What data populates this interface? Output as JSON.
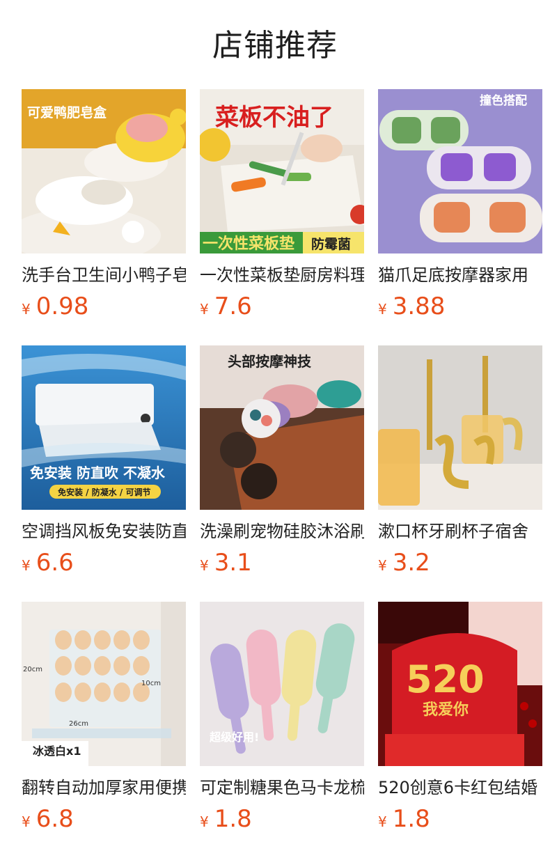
{
  "header": {
    "title": "店铺推荐"
  },
  "products": [
    {
      "name": "洗手台卫生间小鸭子皂盒",
      "currency": "¥",
      "price": "0.98",
      "image_text": "可爱鸭肥皂盒",
      "image_icon": "duck-soap-dish-icon"
    },
    {
      "name": "一次性菜板垫厨房料理",
      "currency": "¥",
      "price": "7.6",
      "image_text": "菜板不油了",
      "image_text2": "一次性菜板垫",
      "image_text3": "防霉菌",
      "image_icon": "cutting-board-mat-icon"
    },
    {
      "name": "猫爪足底按摩器家用",
      "currency": "¥",
      "price": "3.88",
      "image_text": "撞色搭配",
      "image_icon": "foot-massager-icon"
    },
    {
      "name": "空调挡风板免安装防直吹",
      "currency": "¥",
      "price": "6.6",
      "image_text": "免安装 防直吹 不凝水",
      "image_text2": "免安装 / 防凝水 / 可调节",
      "image_icon": "ac-deflector-icon"
    },
    {
      "name": "洗澡刷宠物硅胶沐浴刷",
      "currency": "¥",
      "price": "3.1",
      "image_text": "头部按摩神技",
      "image_icon": "bath-brush-icon"
    },
    {
      "name": "漱口杯牙刷杯子宿舍",
      "currency": "¥",
      "price": "3.2",
      "image_icon": "toothbrush-cup-icon"
    },
    {
      "name": "翻转自动加厚家用便携",
      "currency": "¥",
      "price": "6.8",
      "image_text": "冰透白x1",
      "image_text2": "20cm",
      "image_text3": "10cm",
      "image_text4": "26cm",
      "image_icon": "egg-rack-icon"
    },
    {
      "name": "可定制糖果色马卡龙梳子",
      "currency": "¥",
      "price": "1.8",
      "image_text": "超级好用!",
      "image_icon": "candy-comb-icon"
    },
    {
      "name": "520创意6卡红包结婚",
      "currency": "¥",
      "price": "1.8",
      "image_text": "520",
      "image_text2": "我爱你",
      "image_icon": "red-envelope-icon"
    }
  ],
  "colors": {
    "price": "#e84e1a",
    "title": "#1f1f1f"
  }
}
